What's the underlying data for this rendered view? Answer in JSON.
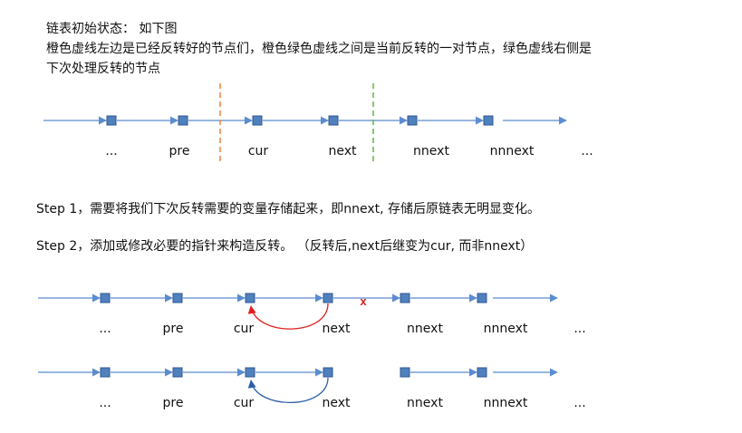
{
  "intro": {
    "line1": "链表初始状态： 如下图",
    "line2": "橙色虚线左边是已经反转好的节点们，橙色绿色虚线之间是当前反转的一对节点，绿色虚线右侧是",
    "line3": "下次处理反转的节点"
  },
  "steps": {
    "step1": "Step 1，需要将我们下次反转需要的变量存储起来，即nnext, 存储后原链表无明显变化。",
    "step2": "Step 2，添加或修改必要的指针来构造反转。 （反转后,next后继变为cur, 而非nnext）"
  },
  "row1_labels": [
    "...",
    "pre",
    "cur",
    "next",
    "nnext",
    "nnnext",
    "..."
  ],
  "row2_labels": [
    "...",
    "pre",
    "cur",
    "next",
    "nnext",
    "nnnext",
    "..."
  ],
  "row3_labels": [
    "...",
    "pre",
    "cur",
    "next",
    "nnext",
    "nnnext",
    "..."
  ],
  "break_mark": "x",
  "colors": {
    "arrow": "#5b8ccf",
    "node_fill": "#4f81bd",
    "node_stroke": "#2f5597",
    "orange_divider": "#f28a4a",
    "green_divider": "#6fb84a",
    "red_arc": "#e0201b",
    "blue_arc": "#2e5fa8",
    "break_mark": "#e0201b"
  }
}
